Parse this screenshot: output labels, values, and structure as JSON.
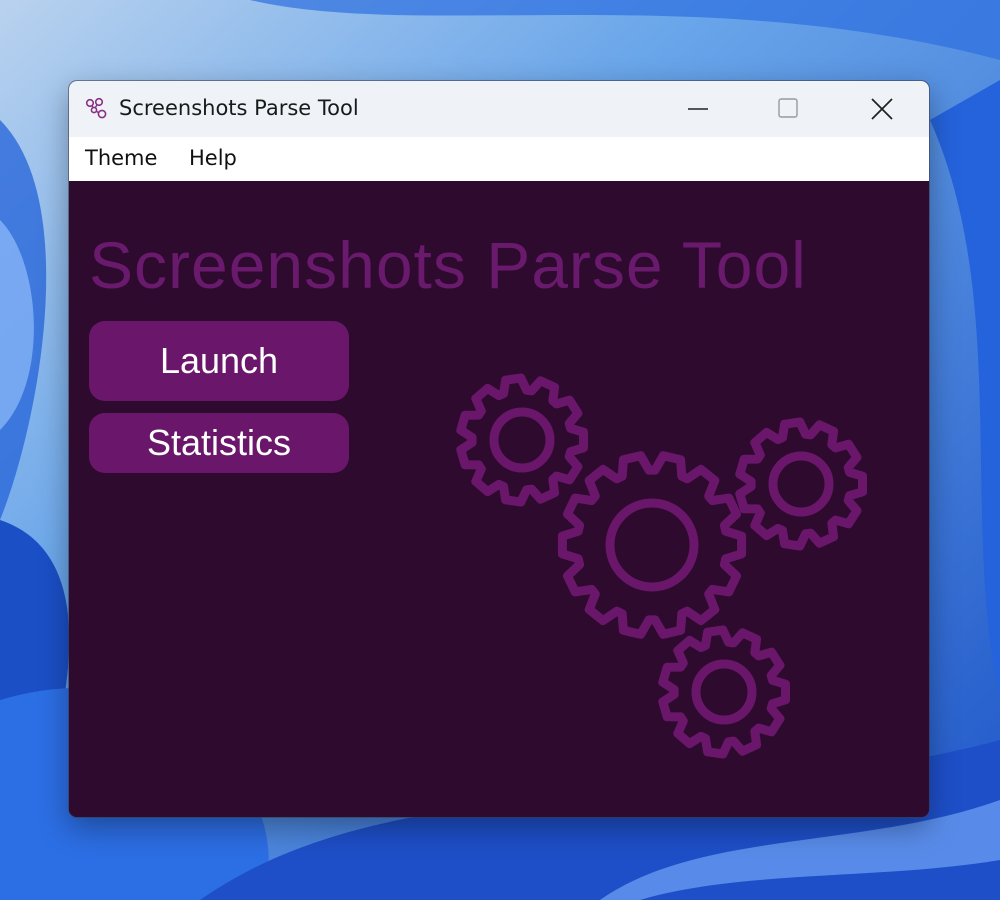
{
  "window": {
    "title": "Screenshots Parse Tool",
    "icon": "app-network-icon",
    "controls": [
      "minimize-icon",
      "maximize-icon",
      "close-icon"
    ]
  },
  "menubar": {
    "items": [
      {
        "label": "Theme"
      },
      {
        "label": "Help"
      }
    ]
  },
  "main": {
    "heading": "Screenshots Parse Tool",
    "buttons": {
      "launch": "Launch",
      "statistics": "Statistics"
    },
    "decoration": "gears-icon"
  },
  "colors": {
    "background": "#2e0a2f",
    "accent": "#6a176b",
    "heading": "#6a1a6c",
    "titlebar": "#eff3f8"
  }
}
